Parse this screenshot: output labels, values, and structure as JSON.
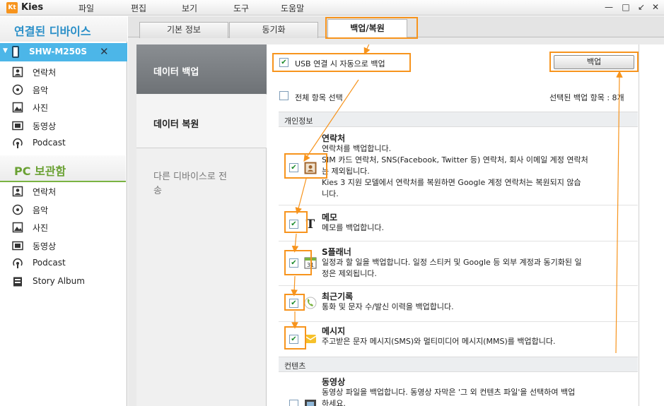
{
  "app": {
    "logo_text": "Kt",
    "title": "Kies",
    "menu": [
      "파일",
      "편집",
      "보기",
      "도구",
      "도움말"
    ],
    "window_controls": [
      "—",
      "□",
      "↙",
      "✕"
    ]
  },
  "sidebar": {
    "connected_header": "연결된 디바이스",
    "device_name": "SHW-M250S",
    "device_close": "✕",
    "device_items": [
      {
        "label": "연락처",
        "icon": "contacts-icon"
      },
      {
        "label": "음악",
        "icon": "music-icon"
      },
      {
        "label": "사진",
        "icon": "photo-icon"
      },
      {
        "label": "동영상",
        "icon": "video-icon"
      },
      {
        "label": "Podcast",
        "icon": "podcast-icon"
      }
    ],
    "pc_header": "PC 보관함",
    "pc_items": [
      {
        "label": "연락처",
        "icon": "contacts-icon"
      },
      {
        "label": "음악",
        "icon": "music-icon"
      },
      {
        "label": "사진",
        "icon": "photo-icon"
      },
      {
        "label": "동영상",
        "icon": "video-icon"
      },
      {
        "label": "Podcast",
        "icon": "podcast-icon"
      },
      {
        "label": "Story Album",
        "icon": "album-icon"
      }
    ]
  },
  "tabs": [
    {
      "label": "기본 정보",
      "active": false
    },
    {
      "label": "동기화",
      "active": false
    },
    {
      "label": "백업/복원",
      "active": true
    }
  ],
  "leftnav": [
    {
      "label": "데이터 백업",
      "active": true
    },
    {
      "label": "데이터 복원",
      "active": false
    },
    {
      "label": "다른 디바이스로 전송",
      "line1": "다른 디바이스로 전",
      "line2": "송",
      "active": false
    }
  ],
  "panel": {
    "auto_backup_label": "USB 연결 시 자동으로 백업",
    "auto_backup_checked": true,
    "backup_button": "백업",
    "select_all_label": "전체 항목 선택",
    "select_all_checked": false,
    "selected_count_label": "선택된 백업 항목 : 8개",
    "groups": [
      {
        "label": "개인정보"
      },
      {
        "label": "컨텐츠"
      }
    ],
    "entries": [
      {
        "title": "연락처",
        "checked": true,
        "icon": "contact-card-icon",
        "desc": [
          "연락처를 백업합니다.",
          "SIM 카드 연락처, SNS(Facebook, Twitter 등) 연락처, 회사 이메일 계정 연락처",
          "는 제외됩니다.",
          "Kies 3 지원 모델에서 연락처를 복원하면 Google 계정 연락처는 복원되지 않습",
          "니다."
        ]
      },
      {
        "title": "메모",
        "checked": true,
        "icon": "memo-icon",
        "desc": [
          "메모를 백업합니다."
        ]
      },
      {
        "title": "S플래너",
        "checked": true,
        "icon": "calendar-icon",
        "desc": [
          "일정과 할 일을 백업합니다. 일정 스티커 및 Google 등 외부 계정과 동기화된 일",
          "정은 제외됩니다."
        ]
      },
      {
        "title": "최근기록",
        "checked": true,
        "icon": "call-log-icon",
        "desc": [
          "통화 및 문자 수/발신 이력을 백업합니다."
        ]
      },
      {
        "title": "메시지",
        "checked": true,
        "icon": "message-icon",
        "desc": [
          "주고받은 문자 메시지(SMS)와 멀티미디어 메시지(MMS)를 백업합니다."
        ]
      },
      {
        "title": "동영상",
        "checked": false,
        "icon": "video-file-icon",
        "desc": [
          "동영상 파일을 백업합니다. 동영상 자막은 '그 외 컨텐츠 파일'을 선택하여 백업",
          "하세요."
        ]
      }
    ]
  },
  "colors": {
    "accent_orange": "#f7941d",
    "device_blue": "#4cb6e8",
    "connected_header_text": "#2a8fc8",
    "pc_header_text": "#6aa133",
    "nav_active": "#7a7e82"
  }
}
